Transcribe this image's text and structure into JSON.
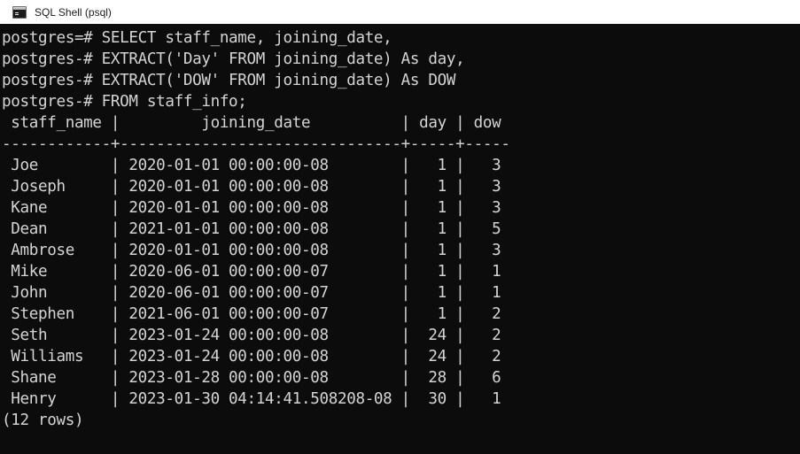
{
  "window": {
    "title": "SQL Shell (psql)",
    "icon": "console-icon",
    "background": "#0c0c0c",
    "text_color": "#d4d4d4",
    "titlebar_background": "#ffffff"
  },
  "terminal": {
    "prompt_primary": "postgres=#",
    "prompt_continuation": "postgres-#",
    "query_lines": [
      "postgres=# SELECT staff_name, joining_date,",
      "postgres-# EXTRACT('Day' FROM joining_date) As day,",
      "postgres-# EXTRACT('DOW' FROM joining_date) As DOW",
      "postgres-# FROM staff_info;"
    ],
    "result": {
      "header": " staff_name |         joining_date          | day | dow ",
      "separator": "------------+-------------------------------+-----+-----",
      "columns": [
        "staff_name",
        "joining_date",
        "day",
        "dow"
      ],
      "rows": [
        " Joe        | 2020-01-01 00:00:00-08        |   1 |   3",
        " Joseph     | 2020-01-01 00:00:00-08        |   1 |   3",
        " Kane       | 2020-01-01 00:00:00-08        |   1 |   3",
        " Dean       | 2021-01-01 00:00:00-08        |   1 |   5",
        " Ambrose    | 2020-01-01 00:00:00-08        |   1 |   3",
        " Mike       | 2020-06-01 00:00:00-07        |   1 |   1",
        " John       | 2020-06-01 00:00:00-07        |   1 |   1",
        " Stephen    | 2021-06-01 00:00:00-07        |   1 |   2",
        " Seth       | 2023-01-24 00:00:00-08        |  24 |   2",
        " Williams   | 2023-01-24 00:00:00-08        |  24 |   2",
        " Shane      | 2023-01-28 00:00:00-08        |  28 |   6",
        " Henry      | 2023-01-30 04:14:41.508208-08 |  30 |   1"
      ],
      "row_values": [
        {
          "staff_name": "Joe",
          "joining_date": "2020-01-01 00:00:00-08",
          "day": "1",
          "dow": "3"
        },
        {
          "staff_name": "Joseph",
          "joining_date": "2020-01-01 00:00:00-08",
          "day": "1",
          "dow": "3"
        },
        {
          "staff_name": "Kane",
          "joining_date": "2020-01-01 00:00:00-08",
          "day": "1",
          "dow": "3"
        },
        {
          "staff_name": "Dean",
          "joining_date": "2021-01-01 00:00:00-08",
          "day": "1",
          "dow": "5"
        },
        {
          "staff_name": "Ambrose",
          "joining_date": "2020-01-01 00:00:00-08",
          "day": "1",
          "dow": "3"
        },
        {
          "staff_name": "Mike",
          "joining_date": "2020-06-01 00:00:00-07",
          "day": "1",
          "dow": "1"
        },
        {
          "staff_name": "John",
          "joining_date": "2020-06-01 00:00:00-07",
          "day": "1",
          "dow": "1"
        },
        {
          "staff_name": "Stephen",
          "joining_date": "2021-06-01 00:00:00-07",
          "day": "1",
          "dow": "2"
        },
        {
          "staff_name": "Seth",
          "joining_date": "2023-01-24 00:00:00-08",
          "day": "24",
          "dow": "2"
        },
        {
          "staff_name": "Williams",
          "joining_date": "2023-01-24 00:00:00-08",
          "day": "24",
          "dow": "2"
        },
        {
          "staff_name": "Shane",
          "joining_date": "2023-01-28 00:00:00-08",
          "day": "28",
          "dow": "6"
        },
        {
          "staff_name": "Henry",
          "joining_date": "2023-01-30 04:14:41.508208-08",
          "day": "30",
          "dow": "1"
        }
      ],
      "row_count_label": "(12 rows)"
    }
  }
}
